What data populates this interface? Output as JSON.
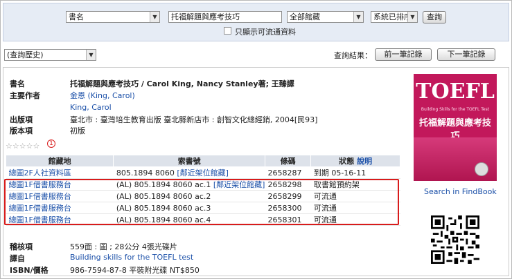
{
  "search": {
    "field_select": "書名",
    "query": "托福解題與應考技巧",
    "collection_select": "全部館藏",
    "sort_select": "系統已排序",
    "search_button": "查詢",
    "available_only_label": "只顯示可流通資料"
  },
  "history": {
    "select_value": "(查詢歷史)",
    "result_label": "查詢結果：",
    "prev_button": "前一筆記錄",
    "next_button": "下一筆記錄"
  },
  "record": {
    "title_label": "書名",
    "title_value": "托福解題與應考技巧 / Carol King, Nancy Stanley著; 王臻譯",
    "author_label": "主要作者",
    "author_link": "金恩 (King, Carol)",
    "author_alt": "King, Carol",
    "publisher_label": "出版項",
    "publisher_value": "臺北市 : 臺灣培生教育出版 臺北縣新店市 : 創智文化總經銷, 2004[民93]",
    "edition_label": "版本項",
    "edition_value": "初版",
    "rating_stars": "☆☆☆☆☆",
    "review_count": "1"
  },
  "holdings": {
    "headers": [
      "館藏地",
      "索書號",
      "條碼",
      "狀態"
    ],
    "status_help": "說明",
    "rows": [
      {
        "location": "總圖2F人社資料區",
        "callno": "805.1894 8060",
        "shelf_link": "[鄰近架位館藏]",
        "barcode": "2658287",
        "status": "到期  05-16-11"
      },
      {
        "location": "總圖1F借書服務台",
        "callno": "(AL) 805.1894 8060  ac.1",
        "shelf_link": "[鄰近架位館藏]",
        "barcode": "2658298",
        "status": "取書館預約架"
      },
      {
        "location": "總圖1F借書服務台",
        "callno": "(AL) 805.1894 8060  ac.2",
        "shelf_link": "",
        "barcode": "2658299",
        "status": "可流通"
      },
      {
        "location": "總圖1F借書服務台",
        "callno": "(AL) 805.1894 8060  ac.3",
        "shelf_link": "",
        "barcode": "2658300",
        "status": "可流通"
      },
      {
        "location": "總圖1F借書服務台",
        "callno": "(AL) 805.1894 8060  ac.4",
        "shelf_link": "",
        "barcode": "2658301",
        "status": "可流通"
      }
    ]
  },
  "details": {
    "collation_label": "稽核項",
    "collation_value": "559面 : 圖 ; 28公分 4張光碟片",
    "translation_label": "譯自",
    "translation_value": "Building skills for the TOEFL test",
    "isbn_label": "ISBN/價格",
    "isbn_value": "986-7594-87-8 平裝附光碟 NT$850"
  },
  "sidebar": {
    "cover_logo": "TOEFL",
    "cover_subtitle": "Building Skills for the TOEFL Test",
    "cover_title": "托福解題與應考技巧",
    "findbook_link": "Search in FindBook"
  },
  "colors": {
    "highlight": "#d81b1b",
    "link": "#1a4fa8",
    "panel": "#e6ecf5"
  }
}
